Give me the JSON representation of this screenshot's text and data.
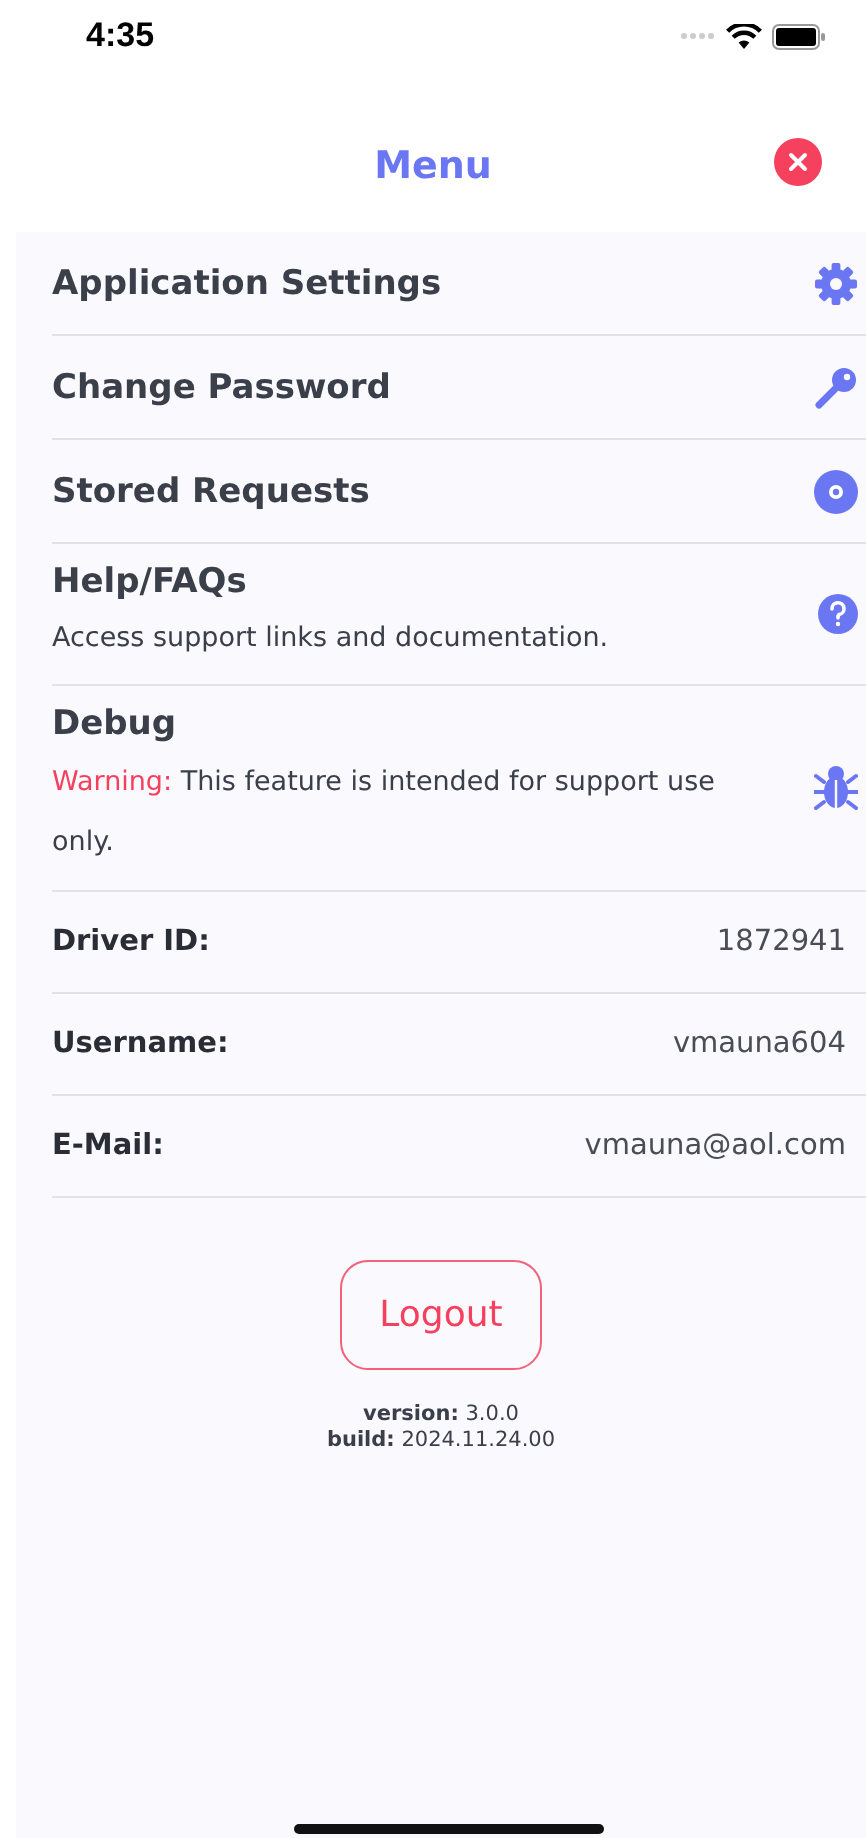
{
  "status_bar": {
    "time": "4:35"
  },
  "header": {
    "title": "Menu"
  },
  "menu_items": [
    {
      "kind": "simple",
      "label": "Application Settings"
    },
    {
      "kind": "simple",
      "label": "Change Password"
    },
    {
      "kind": "simple",
      "label": "Stored Requests"
    },
    {
      "kind": "described",
      "label": "Help/FAQs",
      "description": "Access support links and documentation."
    },
    {
      "kind": "warning",
      "label": "Debug",
      "warning_label": "Warning:",
      "description": "This feature is intended for support use only."
    }
  ],
  "account_info": [
    {
      "label": "Driver ID:",
      "value": "1872941"
    },
    {
      "label": "Username:",
      "value": "vmauna604"
    },
    {
      "label": "E-Mail:",
      "value": "vmauna@aol.com"
    }
  ],
  "logout_button": "Logout",
  "version_lines": [
    "**version:** 3.0.0",
    "**build:** 2024.11.24.00"
  ]
}
